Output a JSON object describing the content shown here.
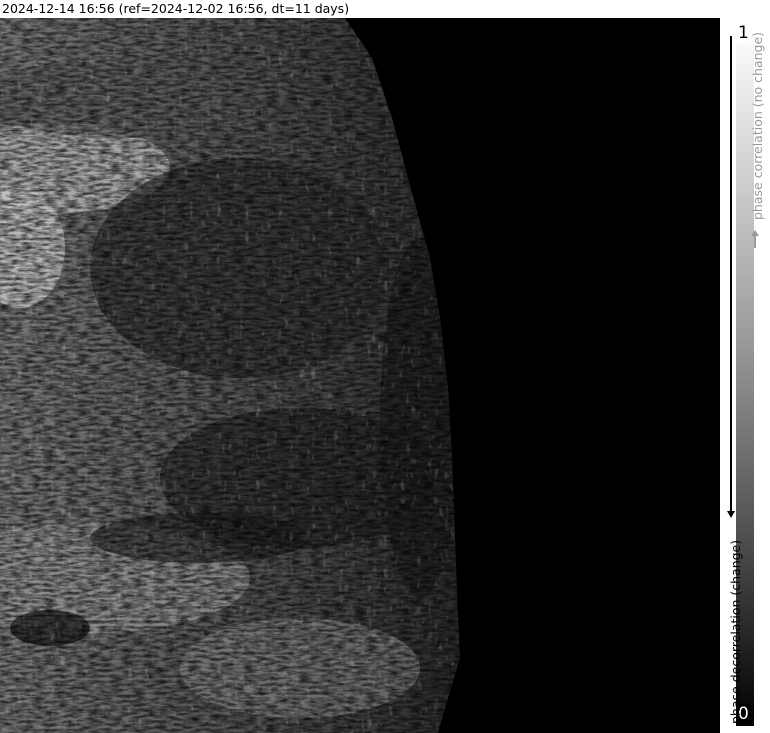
{
  "title": "2024-12-14 16:56 (ref=2024-12-02 16:56, dt=11 days)",
  "colorbar": {
    "max_label": "1",
    "min_label": "0",
    "upper_label": "phase correlation (no change)",
    "lower_label": "phase decorrelation (change)"
  }
}
